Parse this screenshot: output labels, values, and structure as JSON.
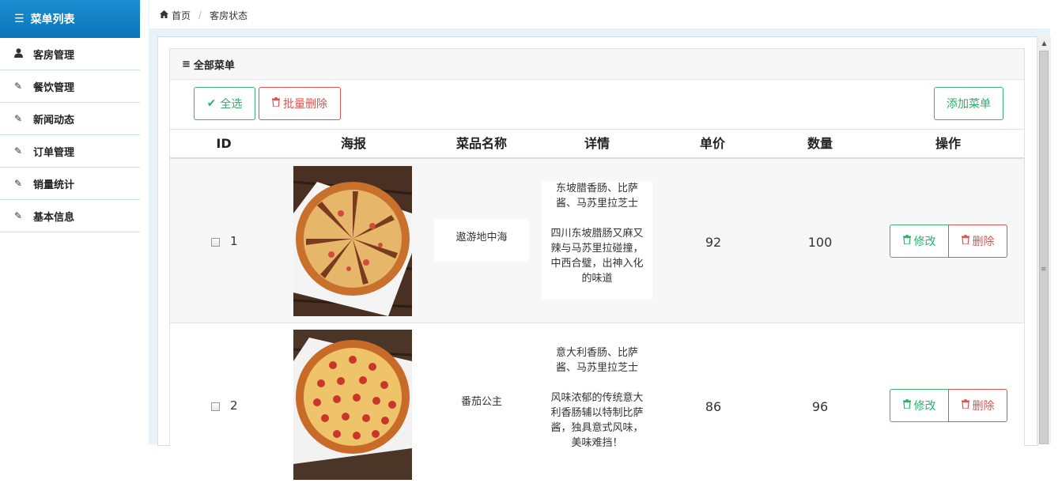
{
  "sidebar": {
    "header": "菜单列表",
    "items": [
      {
        "label": "客房管理",
        "icon": "user-icon"
      },
      {
        "label": "餐饮管理",
        "icon": "edit-icon"
      },
      {
        "label": "新闻动态",
        "icon": "edit-icon"
      },
      {
        "label": "订单管理",
        "icon": "edit-icon"
      },
      {
        "label": "销量统计",
        "icon": "edit-icon"
      },
      {
        "label": "基本信息",
        "icon": "edit-icon"
      }
    ]
  },
  "breadcrumb": {
    "home": "首页",
    "current": "客房状态"
  },
  "panel": {
    "title": "全部菜单",
    "select_all": "全选",
    "batch_delete": "批量删除",
    "add_menu": "添加菜单"
  },
  "table": {
    "headers": [
      "ID",
      "海报",
      "菜品名称",
      "详情",
      "单价",
      "数量",
      "操作"
    ],
    "rows": [
      {
        "id": "1",
        "name": "遨游地中海",
        "detail_1": "东坡腊香肠、比萨酱、马苏里拉芝士",
        "detail_2": "四川东坡腊肠又麻又辣与马苏里拉碰撞，中西合璧，出神入化的味道",
        "price": "92",
        "qty": "100",
        "edit": "修改",
        "delete": "删除"
      },
      {
        "id": "2",
        "name": "番茄公主",
        "detail_1": "意大利香肠、比萨酱、马苏里拉芝士",
        "detail_2": "风味浓郁的传统意大利香肠辅以特制比萨酱，独具意式风味，美味难挡！",
        "price": "86",
        "qty": "96",
        "edit": "修改",
        "delete": "删除"
      }
    ]
  },
  "colors": {
    "sidebar_header": "#0b75b8",
    "green": "#2dae6a",
    "red": "#d9534f"
  }
}
